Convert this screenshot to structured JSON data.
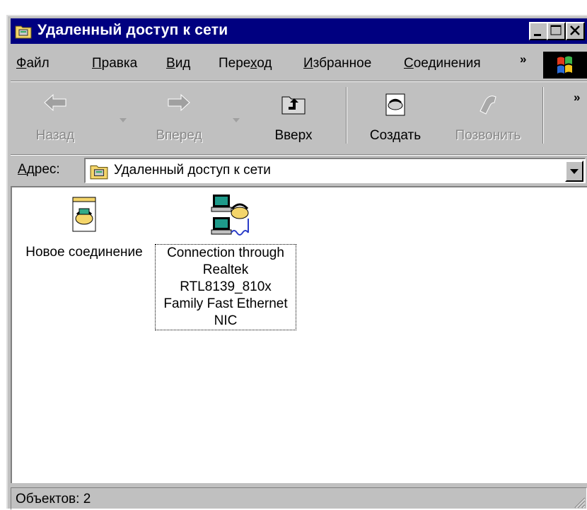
{
  "window": {
    "title": "Удаленный доступ к сети"
  },
  "menu": {
    "items": [
      {
        "accel": "Ф",
        "rest": "айл"
      },
      {
        "accel": "П",
        "rest": "равка"
      },
      {
        "accel": "В",
        "rest": "ид"
      },
      {
        "pre": "Пере",
        "accel": "х",
        "rest": "од"
      },
      {
        "accel": "И",
        "rest": "збранное"
      },
      {
        "accel": "С",
        "rest": "оединения"
      }
    ],
    "overflow_glyph": "»"
  },
  "toolbar": {
    "back_label": "Назад",
    "forward_label": "Вперед",
    "up_label": "Вверх",
    "create_label": "Создать",
    "dial_label": "Позвонить",
    "overflow_glyph": "»"
  },
  "address": {
    "label_accel": "А",
    "label_rest": "дрес:",
    "value": "Удаленный доступ к сети"
  },
  "items": [
    {
      "lines": [
        "Новое соединение"
      ],
      "icon": "new-connection-icon",
      "selected": false
    },
    {
      "lines": [
        "Connection through",
        "Realtek",
        "RTL8139_810x",
        "Family Fast Ethernet",
        "NIC"
      ],
      "icon": "connection-icon",
      "selected": true
    }
  ],
  "status": {
    "text": "Объектов: 2"
  },
  "colors": {
    "titlebar": "#000080",
    "face": "#c0c0c0",
    "window": "#ffffff"
  }
}
